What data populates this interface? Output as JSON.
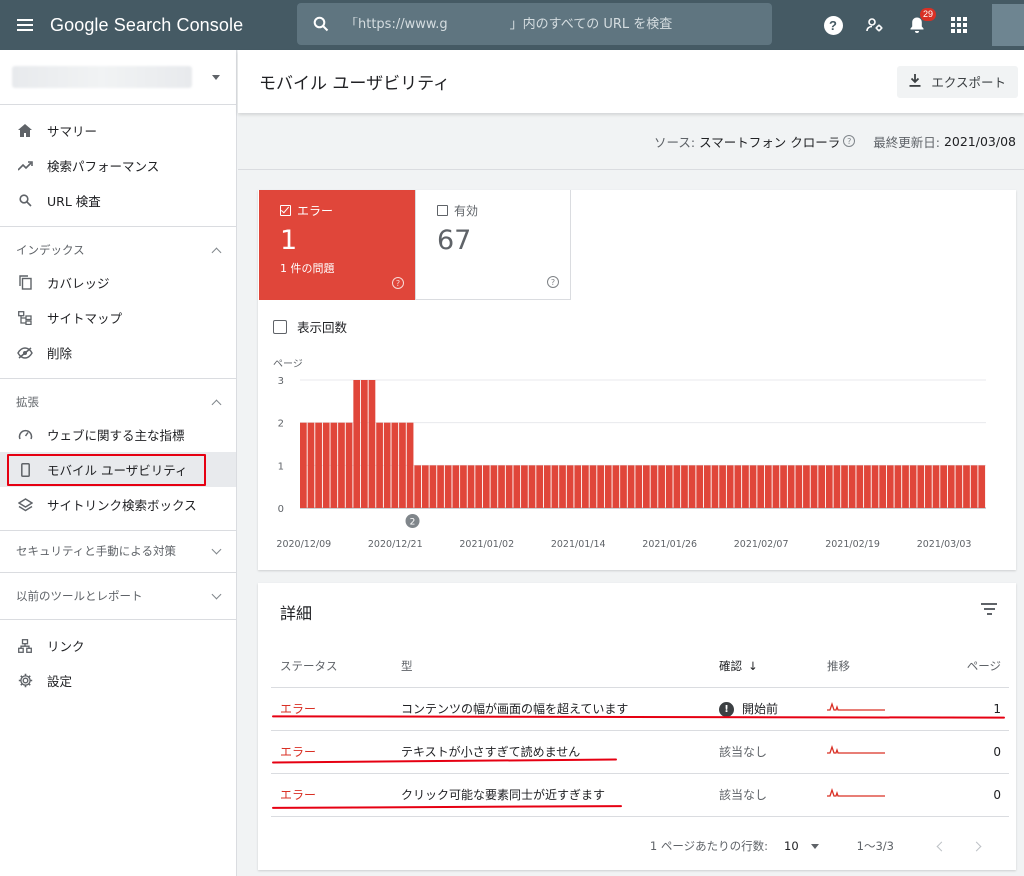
{
  "app": {
    "title": "Google Search Console",
    "search_placeholder": "「https://www.g               」内のすべての URL を検査",
    "notification_count": "29"
  },
  "sidebar": {
    "primary": [
      {
        "label": "サマリー",
        "icon": "home-icon"
      },
      {
        "label": "検索パフォーマンス",
        "icon": "trending-up-icon"
      },
      {
        "label": "URL 検査",
        "icon": "search-icon"
      }
    ],
    "index_header": "インデックス",
    "index_items": [
      {
        "label": "カバレッジ",
        "icon": "copy-icon"
      },
      {
        "label": "サイトマップ",
        "icon": "sitemap-icon"
      },
      {
        "label": "削除",
        "icon": "eye-off-icon"
      }
    ],
    "enhancements_header": "拡張",
    "enhancements_items": [
      {
        "label": "ウェブに関する主な指標",
        "icon": "speedometer-icon"
      },
      {
        "label": "モバイル ユーザビリティ",
        "icon": "smartphone-icon"
      },
      {
        "label": "サイトリンク検索ボックス",
        "icon": "layers-icon"
      }
    ],
    "security_header": "セキュリティと手動による対策",
    "legacy_header": "以前のツールとレポート",
    "bottom_items": [
      {
        "label": "リンク",
        "icon": "links-icon"
      },
      {
        "label": "設定",
        "icon": "gear-icon"
      }
    ]
  },
  "header": {
    "title": "モバイル ユーザビリティ",
    "export_label": "エクスポート"
  },
  "source": {
    "label": "ソース:",
    "value": "スマートフォン クローラ",
    "updated_label": "最終更新日:",
    "updated_value": "2021/03/08"
  },
  "tiles": {
    "error_label": "エラー",
    "error_count": "1",
    "error_sub": "1 件の問題",
    "valid_label": "有効",
    "valid_count": "67"
  },
  "impressions_label": "表示回数",
  "chart_data": {
    "type": "bar",
    "ylabel": "ページ",
    "ylim": [
      0,
      3
    ],
    "yticks": [
      "0",
      "1",
      "2",
      "3"
    ],
    "xticks": [
      "2020/12/09",
      "2020/12/21",
      "2021/01/02",
      "2021/01/14",
      "2021/01/26",
      "2021/02/07",
      "2021/02/19",
      "2021/03/03"
    ],
    "annotation": "2",
    "color": "#e0463a",
    "values": [
      2,
      2,
      2,
      2,
      2,
      2,
      2,
      3,
      3,
      3,
      2,
      2,
      2,
      2,
      2,
      1,
      1,
      1,
      1,
      1,
      1,
      1,
      1,
      1,
      1,
      1,
      1,
      1,
      1,
      1,
      1,
      1,
      1,
      1,
      1,
      1,
      1,
      1,
      1,
      1,
      1,
      1,
      1,
      1,
      1,
      1,
      1,
      1,
      1,
      1,
      1,
      1,
      1,
      1,
      1,
      1,
      1,
      1,
      1,
      1,
      1,
      1,
      1,
      1,
      1,
      1,
      1,
      1,
      1,
      1,
      1,
      1,
      1,
      1,
      1,
      1,
      1,
      1,
      1,
      1,
      1,
      1,
      1,
      1,
      1,
      1,
      1,
      1,
      1,
      1
    ]
  },
  "details": {
    "title": "詳細",
    "columns": [
      "ステータス",
      "型",
      "確認",
      "推移",
      "ページ"
    ],
    "rows": [
      {
        "status": "エラー",
        "type": "コンテンツの幅が画面の幅を超えています",
        "confirm": "開始前",
        "pages": "1"
      },
      {
        "status": "エラー",
        "type": "テキストが小さすぎて読めません",
        "confirm": "該当なし",
        "pages": "0"
      },
      {
        "status": "エラー",
        "type": "クリック可能な要素同士が近すぎます",
        "confirm": "該当なし",
        "pages": "0"
      }
    ],
    "rows_per_page_label": "1 ページあたりの行数:",
    "rows_per_page": "10",
    "range": "1～3/3"
  }
}
